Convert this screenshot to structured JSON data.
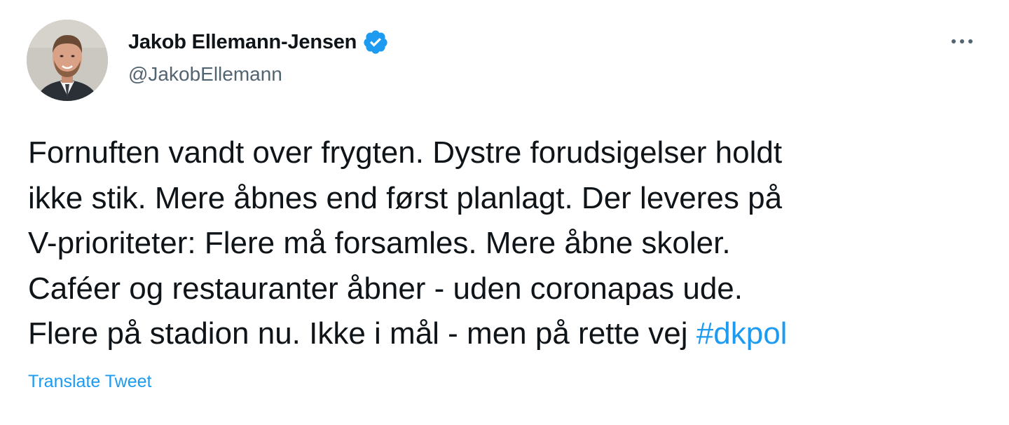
{
  "author": {
    "display_name": "Jakob Ellemann-Jensen",
    "handle": "@JakobEllemann",
    "verified": true,
    "avatar_icon": "avatar-photo",
    "verified_icon": "verified-badge-icon"
  },
  "menu": {
    "icon": "more-options-icon"
  },
  "tweet": {
    "lines": [
      "Fornuften vandt over frygten. Dystre forudsigelser holdt",
      "ikke stik. Mere åbnes end først planlagt. Der leveres på",
      "V-prioriteter: Flere må forsamles. Mere åbne skoler.",
      "Caféer og restauranter åbner - uden coronapas ude.",
      "Flere på stadion nu. Ikke i mål - men på rette vej "
    ],
    "hashtag": "#dkpol"
  },
  "actions": {
    "translate_label": "Translate Tweet"
  },
  "colors": {
    "accent": "#1d9bf0",
    "text": "#0f1419",
    "secondary": "#536471",
    "background": "#ffffff"
  }
}
